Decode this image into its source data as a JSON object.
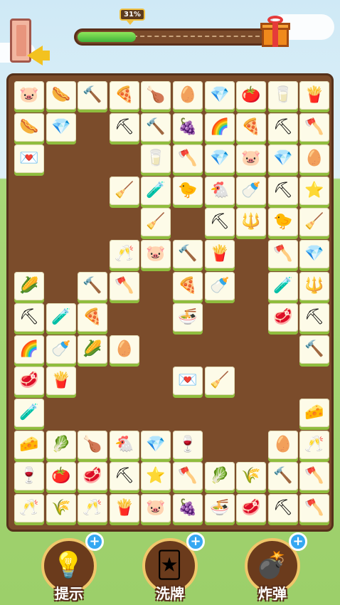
{
  "progress": {
    "value": 0.31,
    "label": "31%"
  },
  "colors": {
    "board": "#7b4c2b",
    "tile_face": "#fdfbe8",
    "tile_edge": "#8fbd3e",
    "progress_fill": "#3fb23a",
    "plus_badge": "#36a8f2"
  },
  "grid": {
    "columns": 10,
    "rows": 14
  },
  "tiles": [
    {
      "r": 0,
      "c": 0,
      "icon": "pig-icon",
      "glyph": "🐷"
    },
    {
      "r": 0,
      "c": 1,
      "icon": "hotdog-icon",
      "glyph": "🌭"
    },
    {
      "r": 0,
      "c": 2,
      "icon": "hammer-icon",
      "glyph": "🔨"
    },
    {
      "r": 0,
      "c": 3,
      "icon": "pizza-icon",
      "glyph": "🍕"
    },
    {
      "r": 0,
      "c": 4,
      "icon": "drumstick-icon",
      "glyph": "🍗"
    },
    {
      "r": 0,
      "c": 5,
      "icon": "egg-icon",
      "glyph": "🥚"
    },
    {
      "r": 0,
      "c": 6,
      "icon": "diamond-icon",
      "glyph": "💎"
    },
    {
      "r": 0,
      "c": 7,
      "icon": "tomato-icon",
      "glyph": "🍅"
    },
    {
      "r": 0,
      "c": 8,
      "icon": "glass-icon",
      "glyph": "🥛"
    },
    {
      "r": 0,
      "c": 9,
      "icon": "fries-icon",
      "glyph": "🍟"
    },
    {
      "r": 1,
      "c": 0,
      "icon": "hotdog-icon",
      "glyph": "🌭"
    },
    {
      "r": 1,
      "c": 1,
      "icon": "diamond-icon",
      "glyph": "💎"
    },
    {
      "r": 1,
      "c": 3,
      "icon": "sickle-icon",
      "glyph": "⛏"
    },
    {
      "r": 1,
      "c": 4,
      "icon": "hammer-icon",
      "glyph": "🔨"
    },
    {
      "r": 1,
      "c": 5,
      "icon": "grapes-icon",
      "glyph": "🍇"
    },
    {
      "r": 1,
      "c": 6,
      "icon": "rainbow-ball-icon",
      "glyph": "🌈"
    },
    {
      "r": 1,
      "c": 7,
      "icon": "pizza-icon",
      "glyph": "🍕"
    },
    {
      "r": 1,
      "c": 8,
      "icon": "shovel-icon",
      "glyph": "⛏"
    },
    {
      "r": 1,
      "c": 9,
      "icon": "axe-icon",
      "glyph": "🪓"
    },
    {
      "r": 2,
      "c": 0,
      "icon": "envelope-icon",
      "glyph": "💌"
    },
    {
      "r": 2,
      "c": 4,
      "icon": "glass-icon",
      "glyph": "🥛"
    },
    {
      "r": 2,
      "c": 5,
      "icon": "axe-icon",
      "glyph": "🪓"
    },
    {
      "r": 2,
      "c": 6,
      "icon": "diamond-icon",
      "glyph": "💎"
    },
    {
      "r": 2,
      "c": 7,
      "icon": "pig-icon",
      "glyph": "🐷"
    },
    {
      "r": 2,
      "c": 8,
      "icon": "diamond-icon",
      "glyph": "💎"
    },
    {
      "r": 2,
      "c": 9,
      "icon": "egg-icon",
      "glyph": "🥚"
    },
    {
      "r": 3,
      "c": 3,
      "icon": "broom-icon",
      "glyph": "🧹"
    },
    {
      "r": 3,
      "c": 4,
      "icon": "potion-icon",
      "glyph": "🧪"
    },
    {
      "r": 3,
      "c": 5,
      "icon": "chick-icon",
      "glyph": "🐤"
    },
    {
      "r": 3,
      "c": 6,
      "icon": "chicken-icon",
      "glyph": "🐔"
    },
    {
      "r": 3,
      "c": 7,
      "icon": "milk-bottle-icon",
      "glyph": "🍼"
    },
    {
      "r": 3,
      "c": 8,
      "icon": "shovel-icon",
      "glyph": "⛏"
    },
    {
      "r": 3,
      "c": 9,
      "icon": "star-icon",
      "glyph": "⭐"
    },
    {
      "r": 4,
      "c": 4,
      "icon": "broom-icon",
      "glyph": "🧹"
    },
    {
      "r": 4,
      "c": 6,
      "icon": "shovel-icon",
      "glyph": "⛏"
    },
    {
      "r": 4,
      "c": 7,
      "icon": "rake-icon",
      "glyph": "🔱"
    },
    {
      "r": 4,
      "c": 8,
      "icon": "chick-icon",
      "glyph": "🐤"
    },
    {
      "r": 4,
      "c": 9,
      "icon": "broom-icon",
      "glyph": "🧹"
    },
    {
      "r": 5,
      "c": 3,
      "icon": "wine-glass-icon",
      "glyph": "🥂"
    },
    {
      "r": 5,
      "c": 4,
      "icon": "pig-icon",
      "glyph": "🐷"
    },
    {
      "r": 5,
      "c": 5,
      "icon": "hammer-icon",
      "glyph": "🔨"
    },
    {
      "r": 5,
      "c": 6,
      "icon": "fries-icon",
      "glyph": "🍟"
    },
    {
      "r": 5,
      "c": 8,
      "icon": "axe-icon",
      "glyph": "🪓"
    },
    {
      "r": 5,
      "c": 9,
      "icon": "diamond-icon",
      "glyph": "💎"
    },
    {
      "r": 6,
      "c": 0,
      "icon": "corn-icon",
      "glyph": "🌽"
    },
    {
      "r": 6,
      "c": 2,
      "icon": "hammer-icon",
      "glyph": "🔨"
    },
    {
      "r": 6,
      "c": 3,
      "icon": "axe-icon",
      "glyph": "🪓"
    },
    {
      "r": 6,
      "c": 5,
      "icon": "pizza-icon",
      "glyph": "🍕"
    },
    {
      "r": 6,
      "c": 6,
      "icon": "milk-bottle-icon",
      "glyph": "🍼"
    },
    {
      "r": 6,
      "c": 8,
      "icon": "potion-icon",
      "glyph": "🧪"
    },
    {
      "r": 6,
      "c": 9,
      "icon": "rake-icon",
      "glyph": "🔱"
    },
    {
      "r": 7,
      "c": 0,
      "icon": "shovel-icon",
      "glyph": "⛏"
    },
    {
      "r": 7,
      "c": 1,
      "icon": "potion-icon",
      "glyph": "🧪"
    },
    {
      "r": 7,
      "c": 2,
      "icon": "pizza-icon",
      "glyph": "🍕"
    },
    {
      "r": 7,
      "c": 5,
      "icon": "noodle-bowl-icon",
      "glyph": "🍜"
    },
    {
      "r": 7,
      "c": 8,
      "icon": "steak-icon",
      "glyph": "🥩"
    },
    {
      "r": 7,
      "c": 9,
      "icon": "shovel-icon",
      "glyph": "⛏"
    },
    {
      "r": 8,
      "c": 0,
      "icon": "rainbow-ball-icon",
      "glyph": "🌈"
    },
    {
      "r": 8,
      "c": 1,
      "icon": "milk-bottle-icon",
      "glyph": "🍼"
    },
    {
      "r": 8,
      "c": 2,
      "icon": "corn-icon",
      "glyph": "🌽"
    },
    {
      "r": 8,
      "c": 3,
      "icon": "eggs-icon",
      "glyph": "🥚"
    },
    {
      "r": 8,
      "c": 9,
      "icon": "hammer-icon",
      "glyph": "🔨"
    },
    {
      "r": 9,
      "c": 0,
      "icon": "steak-icon",
      "glyph": "🥩"
    },
    {
      "r": 9,
      "c": 1,
      "icon": "fries-icon",
      "glyph": "🍟"
    },
    {
      "r": 9,
      "c": 5,
      "icon": "envelope-icon",
      "glyph": "💌"
    },
    {
      "r": 9,
      "c": 6,
      "icon": "broom-icon",
      "glyph": "🧹"
    },
    {
      "r": 10,
      "c": 0,
      "icon": "potion-icon",
      "glyph": "🧪"
    },
    {
      "r": 10,
      "c": 9,
      "icon": "cheese-icon",
      "glyph": "🧀"
    },
    {
      "r": 11,
      "c": 0,
      "icon": "cheese-icon",
      "glyph": "🧀"
    },
    {
      "r": 11,
      "c": 1,
      "icon": "leek-icon",
      "glyph": "🥬"
    },
    {
      "r": 11,
      "c": 2,
      "icon": "drumstick-icon",
      "glyph": "🍗"
    },
    {
      "r": 11,
      "c": 3,
      "icon": "chicken-icon",
      "glyph": "🐔"
    },
    {
      "r": 11,
      "c": 4,
      "icon": "diamond-icon",
      "glyph": "💎"
    },
    {
      "r": 11,
      "c": 5,
      "icon": "red-wine-icon",
      "glyph": "🍷"
    },
    {
      "r": 11,
      "c": 8,
      "icon": "eggs-icon",
      "glyph": "🥚"
    },
    {
      "r": 11,
      "c": 9,
      "icon": "wine-glass-icon",
      "glyph": "🥂"
    },
    {
      "r": 12,
      "c": 0,
      "icon": "red-wine-icon",
      "glyph": "🍷"
    },
    {
      "r": 12,
      "c": 1,
      "icon": "tomato-icon",
      "glyph": "🍅"
    },
    {
      "r": 12,
      "c": 2,
      "icon": "steak-icon",
      "glyph": "🥩"
    },
    {
      "r": 12,
      "c": 3,
      "icon": "shovel-icon",
      "glyph": "⛏"
    },
    {
      "r": 12,
      "c": 4,
      "icon": "star-icon",
      "glyph": "⭐"
    },
    {
      "r": 12,
      "c": 5,
      "icon": "axe-icon",
      "glyph": "🪓"
    },
    {
      "r": 12,
      "c": 6,
      "icon": "leek-icon",
      "glyph": "🥬"
    },
    {
      "r": 12,
      "c": 7,
      "icon": "wheat-icon",
      "glyph": "🌾"
    },
    {
      "r": 12,
      "c": 8,
      "icon": "hammer-icon",
      "glyph": "🔨"
    },
    {
      "r": 12,
      "c": 9,
      "icon": "axe-icon",
      "glyph": "🪓"
    },
    {
      "r": 13,
      "c": 0,
      "icon": "wine-glass-icon",
      "glyph": "🥂"
    },
    {
      "r": 13,
      "c": 1,
      "icon": "wheat-icon",
      "glyph": "🌾"
    },
    {
      "r": 13,
      "c": 2,
      "icon": "wine-glass-icon",
      "glyph": "🥂"
    },
    {
      "r": 13,
      "c": 3,
      "icon": "fries-icon",
      "glyph": "🍟"
    },
    {
      "r": 13,
      "c": 4,
      "icon": "pig-icon",
      "glyph": "🐷"
    },
    {
      "r": 13,
      "c": 5,
      "icon": "grapes-icon",
      "glyph": "🍇"
    },
    {
      "r": 13,
      "c": 6,
      "icon": "noodle-bowl-icon",
      "glyph": "🍜"
    },
    {
      "r": 13,
      "c": 7,
      "icon": "steak-icon",
      "glyph": "🥩"
    },
    {
      "r": 13,
      "c": 8,
      "icon": "sickle-icon",
      "glyph": "⛏"
    },
    {
      "r": 13,
      "c": 9,
      "icon": "axe-icon",
      "glyph": "🪓"
    }
  ],
  "powerups": [
    {
      "key": "hint",
      "label": "提示",
      "icon": "lightbulb-icon",
      "glyph": "💡"
    },
    {
      "key": "shuffle",
      "label": "洗牌",
      "icon": "shuffle-cards-icon",
      "glyph": "🃏"
    },
    {
      "key": "bomb",
      "label": "炸弹",
      "icon": "bomb-icon",
      "glyph": "💣"
    }
  ],
  "plus_glyph": "+"
}
